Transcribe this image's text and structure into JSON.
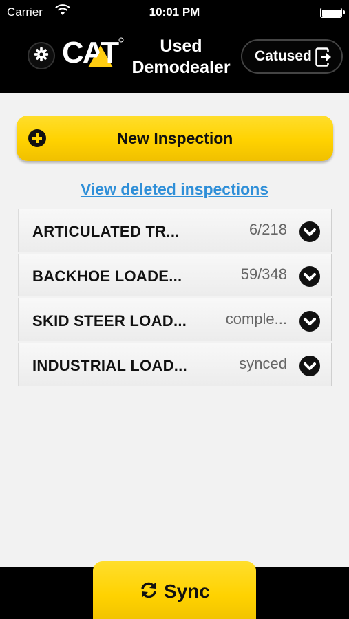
{
  "status_bar": {
    "carrier": "Carrier",
    "time": "10:01 PM"
  },
  "header": {
    "logo_text": "CAT",
    "dealer_line1": "Used",
    "dealer_line2": "Demodealer",
    "user": "Catused"
  },
  "main": {
    "new_inspection_label": "New Inspection",
    "view_deleted_link": "View deleted inspections",
    "inspections": [
      {
        "name": "ARTICULATED TR...",
        "status": "6/218"
      },
      {
        "name": "BACKHOE LOADE...",
        "status": "59/348"
      },
      {
        "name": "SKID STEER LOAD...",
        "status": "comple..."
      },
      {
        "name": "INDUSTRIAL LOAD...",
        "status": "synced"
      }
    ]
  },
  "footer": {
    "sync_label": "Sync"
  },
  "colors": {
    "cat_yellow": "#ffd200",
    "link_blue": "#2f8fd8",
    "header_bg": "#000000",
    "page_bg": "#f2f2f2"
  },
  "icons": {
    "settings": "gear-icon",
    "logout": "logout-icon",
    "add": "plus-circle-icon",
    "expand": "chevron-down-icon",
    "sync": "sync-icon",
    "wifi": "wifi-icon",
    "battery": "battery-icon"
  }
}
